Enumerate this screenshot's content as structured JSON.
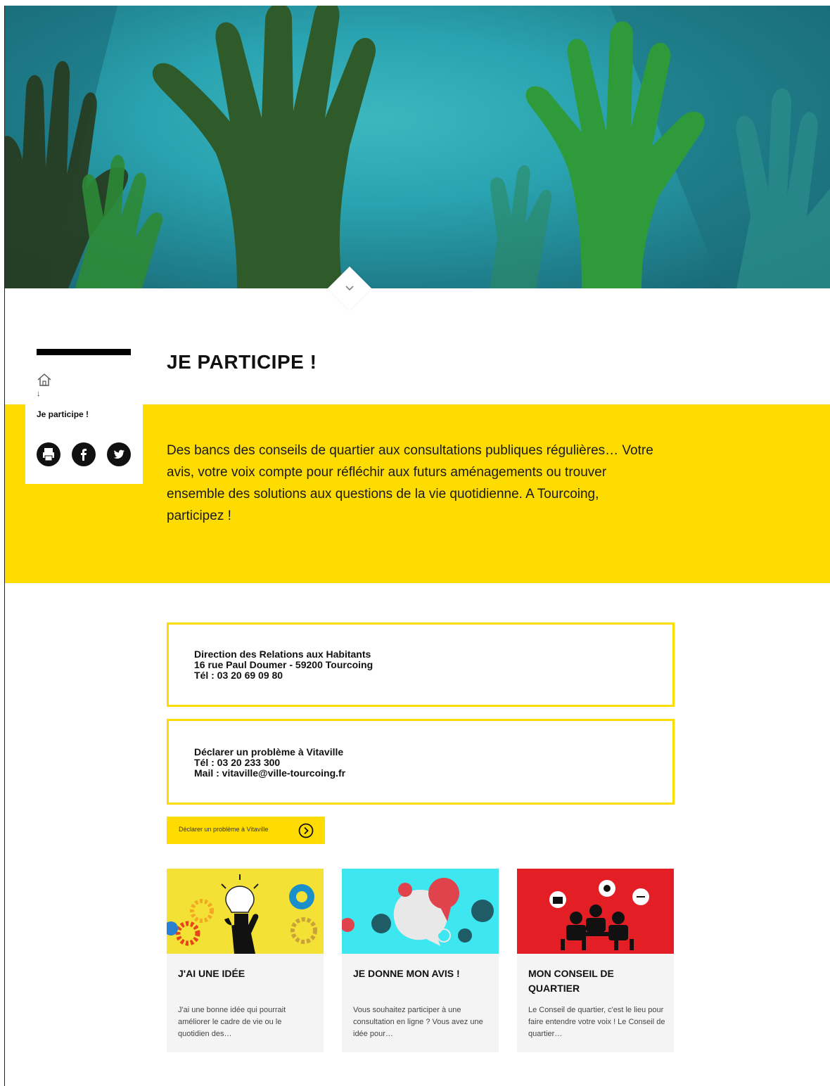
{
  "hero": {
    "scroll_icon": "chevron-down-icon"
  },
  "breadcrumb": {
    "home_icon": "home-icon",
    "separator": "↓",
    "current": "Je participe !"
  },
  "share": {
    "items": [
      {
        "icon": "print-icon"
      },
      {
        "icon": "facebook-icon"
      },
      {
        "icon": "twitter-icon"
      }
    ]
  },
  "page": {
    "title": "JE PARTICIPE !",
    "intro": "Des bancs des conseils de quartier aux consultations publiques régulières… Votre avis, votre voix compte pour réfléchir aux futurs aménagements ou trouver ensemble des solutions aux questions de la vie quotidienne. A Tourcoing, participez !"
  },
  "contact_direction": {
    "line1": "Direction des Relations aux Habitants",
    "line2": "16 rue Paul Doumer - 59200 Tourcoing",
    "line3": "Tél : 03 20 69 09 80"
  },
  "contact_vitaville": {
    "line1": "Déclarer un problème à Vitaville",
    "line2": "Tél : 03 20 233 300",
    "line3": "Mail : vitaville@ville-tourcoing.fr"
  },
  "vitaville_button": {
    "label": "Déclarer un problème à Vitaville",
    "icon": "arrow-right-circle-icon"
  },
  "cards": [
    {
      "title": "J'AI UNE IDÉE",
      "text": "J'ai une bonne idée qui pourrait améliorer le cadre de vie ou le quotidien des…",
      "image": "lightbulb-gears-illustration"
    },
    {
      "title": "JE DONNE MON AVIS !",
      "text": "Vous souhaitez participer à une consultation en ligne ? Vous avez une idée pour…",
      "image": "speech-bubbles-illustration"
    },
    {
      "title": "MON CONSEIL DE QUARTIER",
      "text": "Le Conseil de quartier, c'est le lieu pour faire entendre votre voix ! Le Conseil de quartier…",
      "image": "meeting-table-illustration"
    }
  ],
  "colors": {
    "accent_yellow": "#ffdc00",
    "hero_teal": "#2aa3b0",
    "hand_dark_green": "#2f5a2a",
    "hand_green": "#2e9a3a",
    "card_red": "#e31e24",
    "card_cyan": "#3ee6f0"
  }
}
